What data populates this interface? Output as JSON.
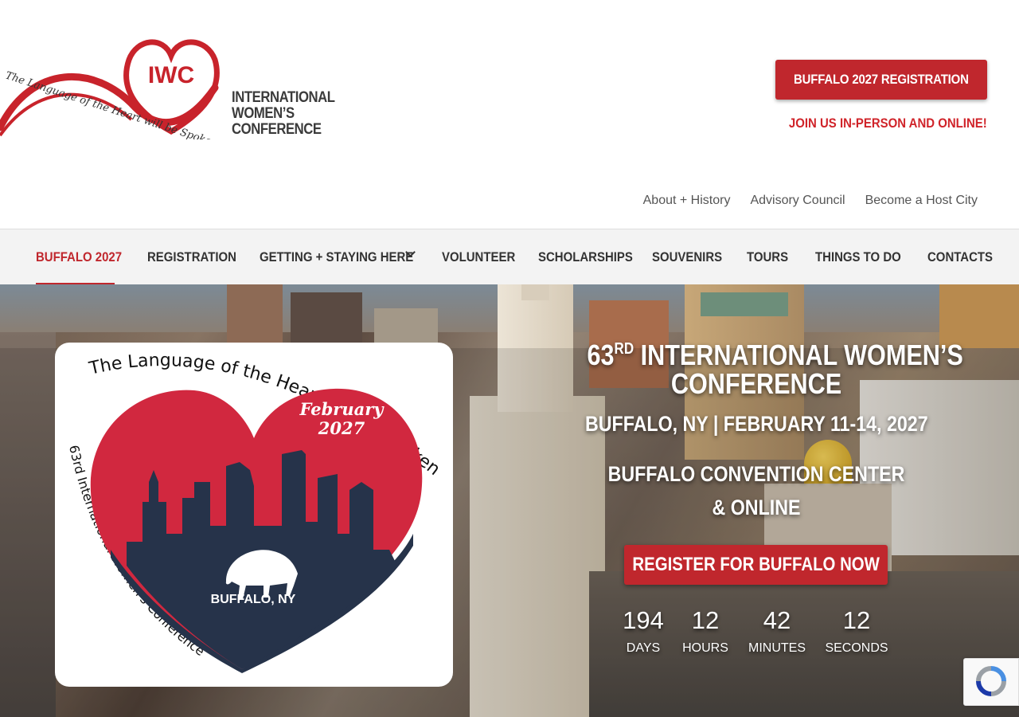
{
  "logo": {
    "monogram": "IWC",
    "tagline": "The Language of the Heart will be Spoken Here",
    "word_lines": [
      "INTERNATIONAL",
      "WOMEN’S",
      "CONFERENCE"
    ]
  },
  "header": {
    "cta_label": "BUFFALO 2027 REGISTRATION",
    "join_text": "JOIN US IN-PERSON AND ONLINE!",
    "util_links": [
      "About + History",
      "Advisory Council",
      "Become a Host City"
    ]
  },
  "nav": {
    "items": [
      "BUFFALO 2027",
      "REGISTRATION",
      "GETTING + STAYING HERE",
      "VOLUNTEER",
      "SCHOLARSHIPS",
      "SOUVENIRS",
      "TOURS",
      "THINGS TO DO",
      "CONTACTS"
    ],
    "active": "BUFFALO 2027"
  },
  "poster": {
    "arc_text": "The Language of the Heart Will Be Spoken Here...",
    "side_text": "63rd International Women's Conference",
    "date_month": "February",
    "date_year": "2027",
    "city": "BUFFALO, NY"
  },
  "hero": {
    "title_num": "63",
    "title_sup": "RD",
    "title_rest": " INTERNATIONAL WOMEN’S",
    "title_line2": "CONFERENCE",
    "location_date": "BUFFALO, NY | FEBRUARY 11-14, 2027",
    "venue_line1": "BUFFALO CONVENTION CENTER",
    "venue_line2": "& ONLINE",
    "cta_label": "REGISTER FOR BUFFALO NOW"
  },
  "countdown": {
    "days": "194",
    "days_label": "DAYS",
    "hours": "12",
    "hours_label": "HOURS",
    "minutes": "42",
    "minutes_label": "MINUTES",
    "seconds": "12",
    "seconds_label": "SECONDS"
  },
  "colors": {
    "brand_red": "#c0272d",
    "nav_bg": "#f3f3f3",
    "poster_navy": "#26334a",
    "poster_red": "#d1283f"
  },
  "icons": [
    "chevron-down-icon",
    "recaptcha-icon",
    "buffalo-icon",
    "heart-icon"
  ]
}
